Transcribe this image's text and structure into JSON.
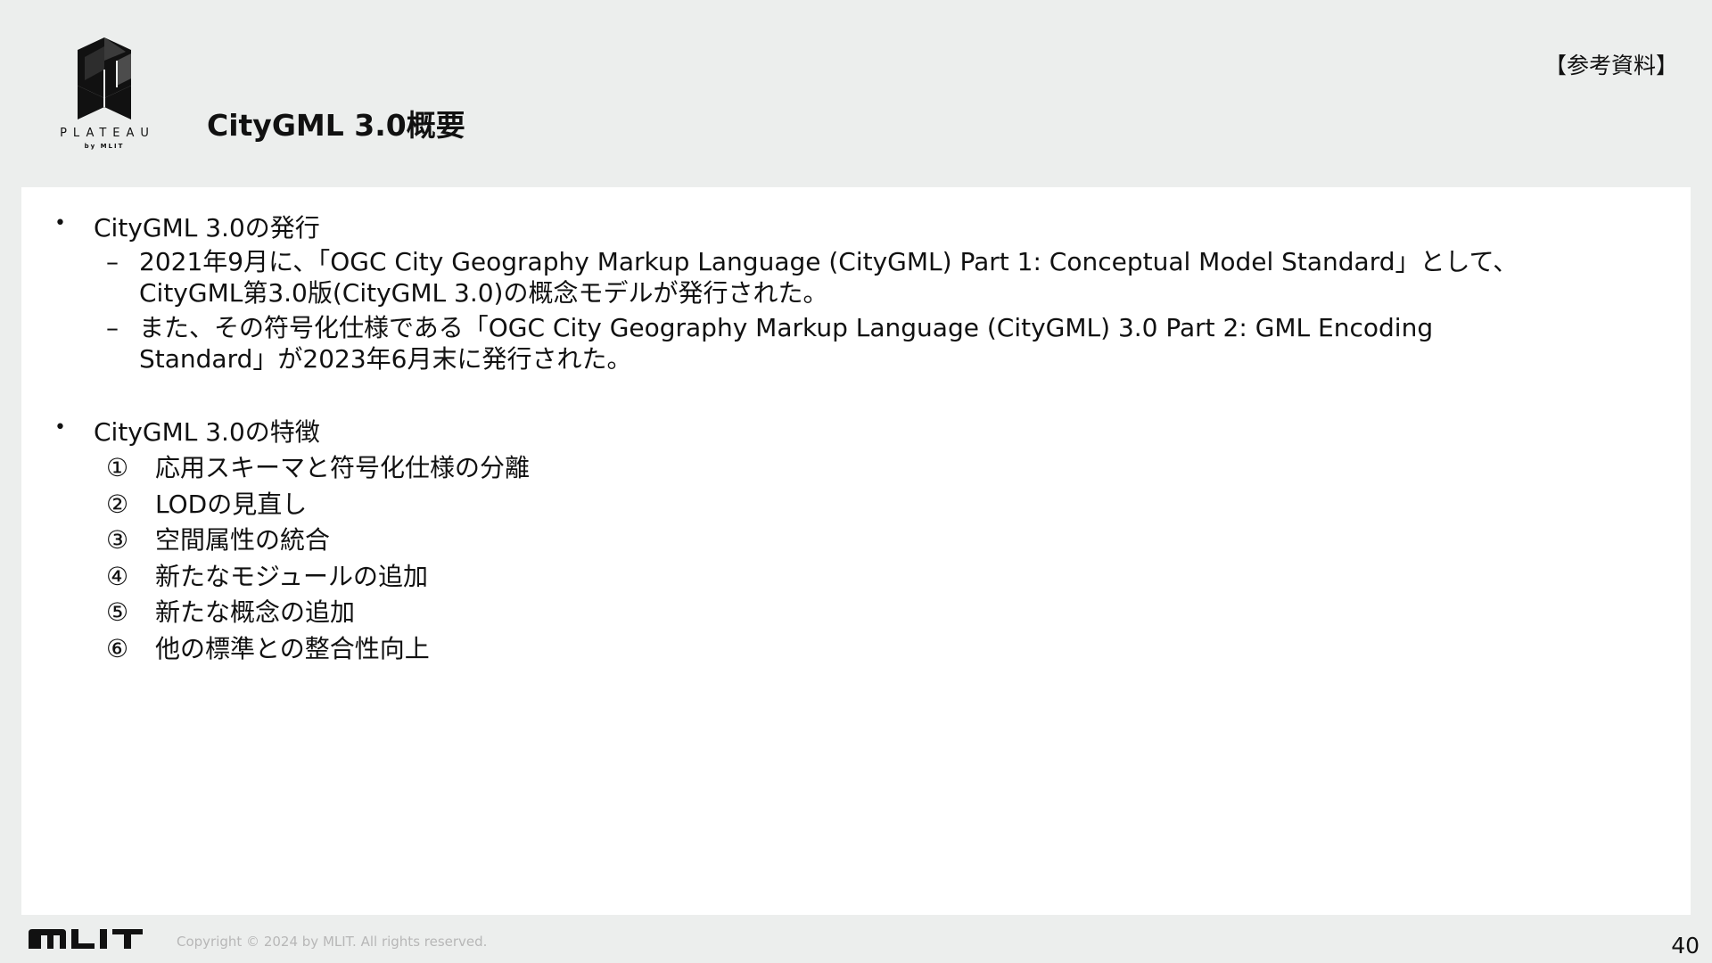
{
  "header": {
    "logo": {
      "icon": "plateau-cube-icon",
      "wordmark": "PLATEAU",
      "subtitle": "by MLIT"
    },
    "title": "CityGML 3.0概要",
    "reference_label": "【参考資料】"
  },
  "sections": [
    {
      "bullet": "•",
      "heading": "CityGML 3.0の発行",
      "sub_items": [
        {
          "mark": "–",
          "text": "2021年9月に、「OGC City Geography Markup Language (CityGML) Part 1: Conceptual Model Standard」として、\nCityGML第3.0版(CityGML 3.0)の概念モデルが発行された。"
        },
        {
          "mark": "–",
          "text": "また、その符号化仕様である「OGC City Geography Markup Language (CityGML) 3.0 Part 2: GML Encoding\nStandard」が2023年6月末に発行された。"
        }
      ]
    },
    {
      "bullet": "•",
      "heading": "CityGML 3.0の特徴",
      "numbered_items": [
        {
          "mark": "①",
          "text": "応用スキーマと符号化仕様の分離"
        },
        {
          "mark": "②",
          "text": "LODの見直し"
        },
        {
          "mark": "③",
          "text": "空間属性の統合"
        },
        {
          "mark": "④",
          "text": "新たなモジュールの追加"
        },
        {
          "mark": "⑤",
          "text": "新たな概念の追加"
        },
        {
          "mark": "⑥",
          "text": "他の標準との整合性向上"
        }
      ]
    }
  ],
  "footer": {
    "logo": "MLIT",
    "copyright": "Copyright © 2024 by MLIT. All rights reserved.",
    "page_number": "40"
  },
  "colors": {
    "page_background": "#eceeed",
    "content_background": "#ffffff",
    "text": "#111111",
    "copyright_text": "#b7b7b7"
  }
}
